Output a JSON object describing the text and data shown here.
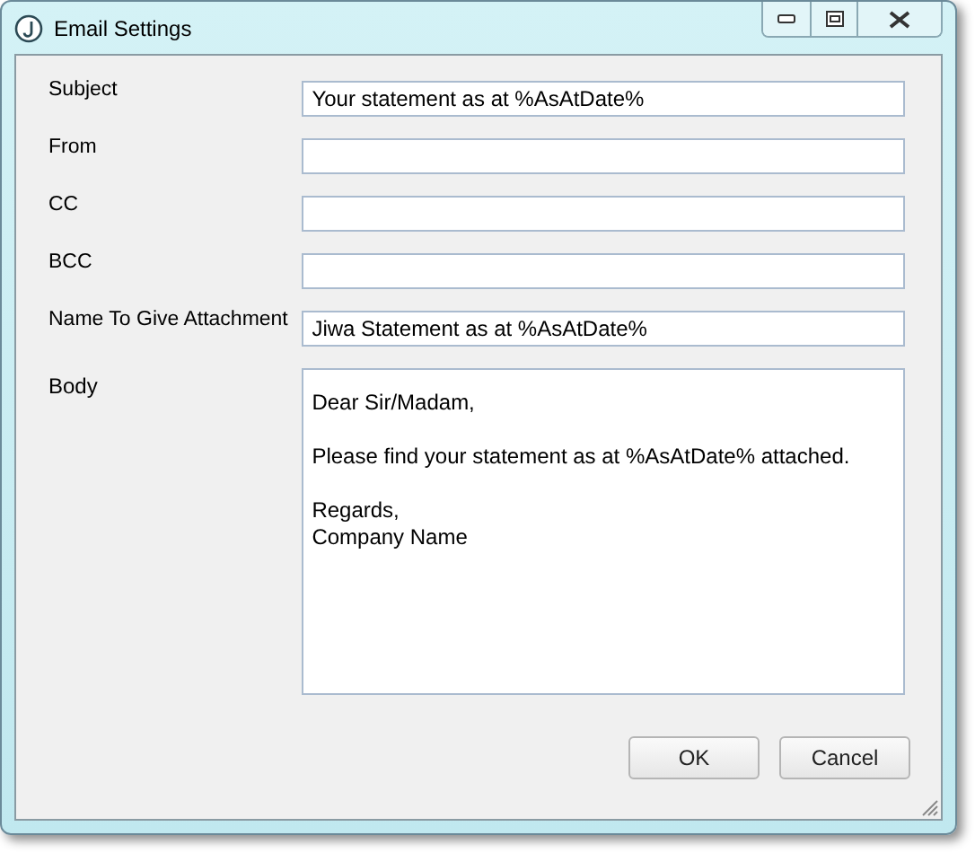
{
  "window": {
    "title": "Email Settings"
  },
  "fields": [
    {
      "label": "Subject",
      "value": "Your statement as at %AsAtDate%"
    },
    {
      "label": "From"
    },
    {
      "label": "CC"
    },
    {
      "label": "BCC"
    },
    {
      "label": "Name To Give Attachment",
      "value": "Jiwa Statement as at %AsAtDate%"
    }
  ],
  "body": {
    "label": "Body",
    "paragraphs": [
      [
        "Dear Sir/Madam,"
      ],
      [
        "Please find your statement as at %AsAtDate% attached."
      ],
      [
        "Regards,",
        "Company Name"
      ]
    ]
  },
  "buttons": [
    "OK",
    "Cancel"
  ]
}
